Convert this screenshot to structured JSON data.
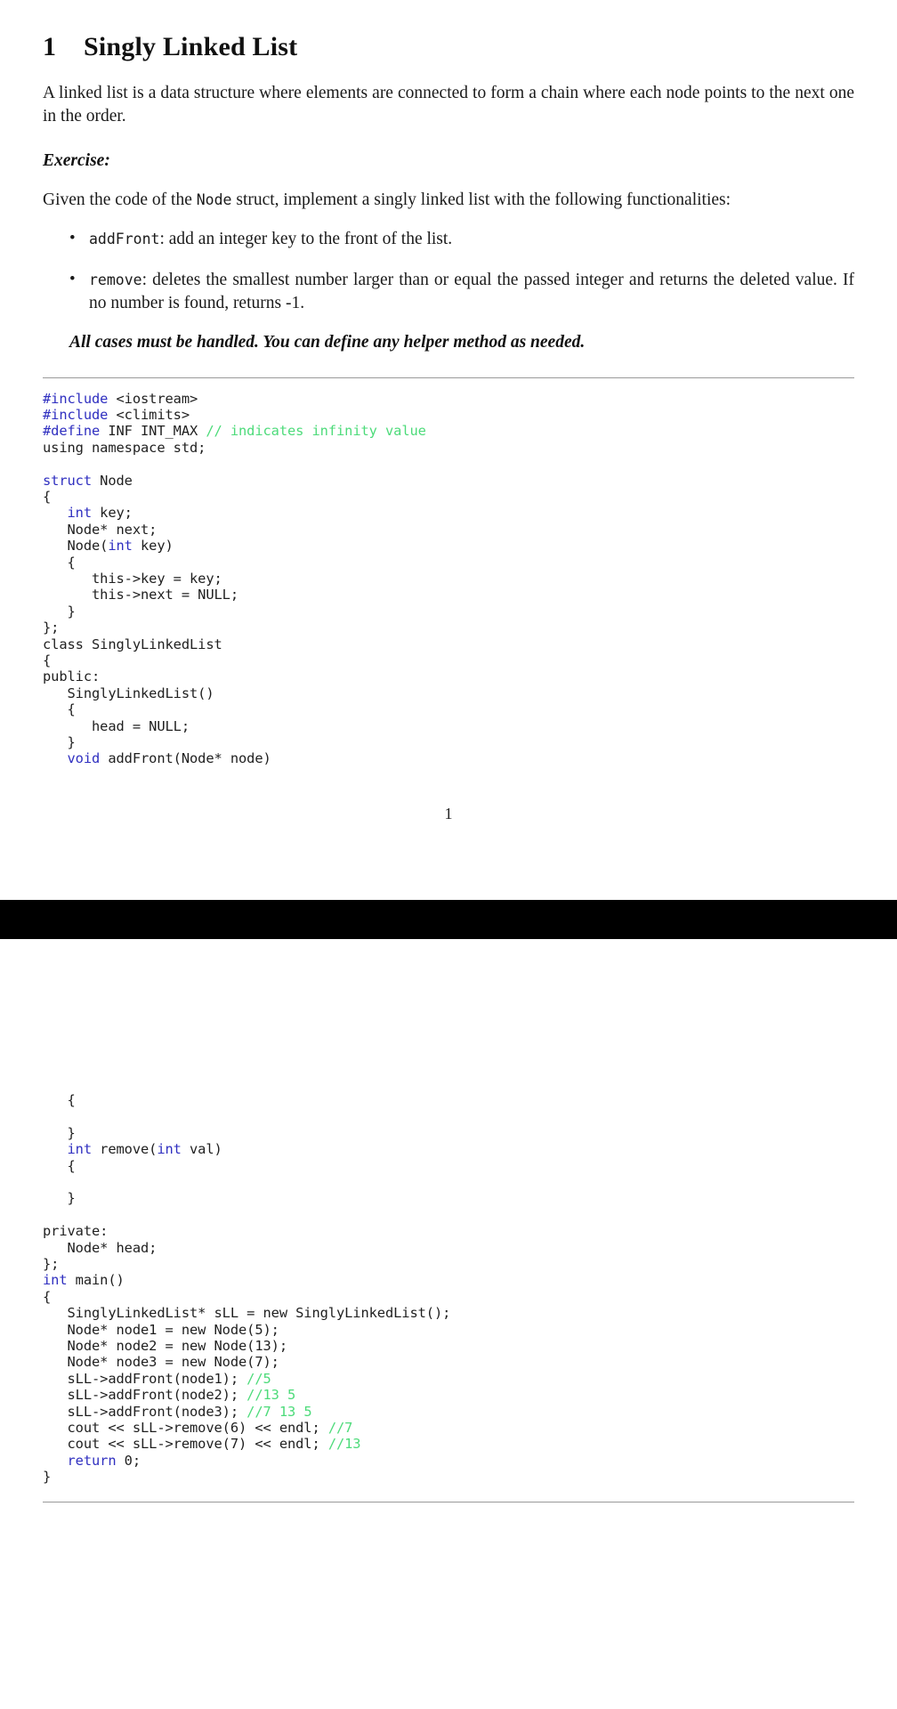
{
  "document": {
    "section_number": "1",
    "section_title": "Singly Linked List",
    "intro_paragraph": "A linked list is a data structure where elements are connected to form a chain where each node points to the next one in the order.",
    "exercise_label": "Exercise:",
    "prompt_prefix": "Given the code of the ",
    "prompt_code": "Node",
    "prompt_suffix": " struct, implement a singly linked list with the following functionalities:",
    "bullets": [
      {
        "code": "addFront",
        "text": ": add an integer key to the front of the list."
      },
      {
        "code": "remove",
        "text": ": deletes the smallest number larger than or equal the passed integer and returns the deleted value. If no number is found, returns -1."
      }
    ],
    "note": "All cases must be handled.  You can define any helper method as needed.",
    "page_number": "1"
  },
  "code_block_1": {
    "language": "cpp",
    "lines": [
      [
        {
          "t": "#include",
          "c": "kw"
        },
        {
          "t": " <iostream>",
          "c": ""
        }
      ],
      [
        {
          "t": "#include",
          "c": "kw"
        },
        {
          "t": " <climits>",
          "c": ""
        }
      ],
      [
        {
          "t": "#define",
          "c": "kw"
        },
        {
          "t": " INF INT_MAX ",
          "c": ""
        },
        {
          "t": "// indicates infinity value",
          "c": "cmt"
        }
      ],
      [
        {
          "t": "using namespace std;",
          "c": ""
        }
      ],
      [
        {
          "t": "",
          "c": ""
        }
      ],
      [
        {
          "t": "struct",
          "c": "kw"
        },
        {
          "t": " Node",
          "c": ""
        }
      ],
      [
        {
          "t": "{",
          "c": ""
        }
      ],
      [
        {
          "t": "   ",
          "c": ""
        },
        {
          "t": "int",
          "c": "kw"
        },
        {
          "t": " key;",
          "c": ""
        }
      ],
      [
        {
          "t": "   Node* next;",
          "c": ""
        }
      ],
      [
        {
          "t": "   Node(",
          "c": ""
        },
        {
          "t": "int",
          "c": "kw"
        },
        {
          "t": " key)",
          "c": ""
        }
      ],
      [
        {
          "t": "   {",
          "c": ""
        }
      ],
      [
        {
          "t": "      this->key = key;",
          "c": ""
        }
      ],
      [
        {
          "t": "      this->next = NULL;",
          "c": ""
        }
      ],
      [
        {
          "t": "   }",
          "c": ""
        }
      ],
      [
        {
          "t": "};",
          "c": ""
        }
      ],
      [
        {
          "t": "class SinglyLinkedList",
          "c": ""
        }
      ],
      [
        {
          "t": "{",
          "c": ""
        }
      ],
      [
        {
          "t": "public:",
          "c": ""
        }
      ],
      [
        {
          "t": "   SinglyLinkedList()",
          "c": ""
        }
      ],
      [
        {
          "t": "   {",
          "c": ""
        }
      ],
      [
        {
          "t": "      head = NULL;",
          "c": ""
        }
      ],
      [
        {
          "t": "   }",
          "c": ""
        }
      ],
      [
        {
          "t": "   ",
          "c": ""
        },
        {
          "t": "void",
          "c": "kw"
        },
        {
          "t": " addFront(Node* node)",
          "c": ""
        }
      ]
    ]
  },
  "code_block_2": {
    "language": "cpp",
    "lines": [
      [
        {
          "t": "   {",
          "c": ""
        }
      ],
      [
        {
          "t": "",
          "c": ""
        }
      ],
      [
        {
          "t": "   }",
          "c": ""
        }
      ],
      [
        {
          "t": "   ",
          "c": ""
        },
        {
          "t": "int",
          "c": "kw"
        },
        {
          "t": " remove(",
          "c": ""
        },
        {
          "t": "int",
          "c": "kw"
        },
        {
          "t": " val)",
          "c": ""
        }
      ],
      [
        {
          "t": "   {",
          "c": ""
        }
      ],
      [
        {
          "t": "",
          "c": ""
        }
      ],
      [
        {
          "t": "   }",
          "c": ""
        }
      ],
      [
        {
          "t": "",
          "c": ""
        }
      ],
      [
        {
          "t": "private:",
          "c": ""
        }
      ],
      [
        {
          "t": "   Node* head;",
          "c": ""
        }
      ],
      [
        {
          "t": "};",
          "c": ""
        }
      ],
      [
        {
          "t": "int",
          "c": "kw"
        },
        {
          "t": " main()",
          "c": ""
        }
      ],
      [
        {
          "t": "{",
          "c": ""
        }
      ],
      [
        {
          "t": "   SinglyLinkedList* sLL = new SinglyLinkedList();",
          "c": ""
        }
      ],
      [
        {
          "t": "   Node* node1 = new Node(5);",
          "c": ""
        }
      ],
      [
        {
          "t": "   Node* node2 = new Node(13);",
          "c": ""
        }
      ],
      [
        {
          "t": "   Node* node3 = new Node(7);",
          "c": ""
        }
      ],
      [
        {
          "t": "   sLL->addFront(node1); ",
          "c": ""
        },
        {
          "t": "//5",
          "c": "cmt"
        }
      ],
      [
        {
          "t": "   sLL->addFront(node2); ",
          "c": ""
        },
        {
          "t": "//13 5",
          "c": "cmt"
        }
      ],
      [
        {
          "t": "   sLL->addFront(node3); ",
          "c": ""
        },
        {
          "t": "//7 13 5",
          "c": "cmt"
        }
      ],
      [
        {
          "t": "   cout << sLL->remove(6) << endl; ",
          "c": ""
        },
        {
          "t": "//7",
          "c": "cmt"
        }
      ],
      [
        {
          "t": "   cout << sLL->remove(7) << endl; ",
          "c": ""
        },
        {
          "t": "//13",
          "c": "cmt"
        }
      ],
      [
        {
          "t": "   ",
          "c": ""
        },
        {
          "t": "return",
          "c": "kw"
        },
        {
          "t": " 0;",
          "c": ""
        }
      ],
      [
        {
          "t": "}",
          "c": ""
        }
      ]
    ]
  },
  "colors": {
    "keyword": "#2f2fc0",
    "comment": "#4ddb7a",
    "text": "#1a1a1a",
    "rule": "#9a9a9a",
    "band": "#000000"
  }
}
